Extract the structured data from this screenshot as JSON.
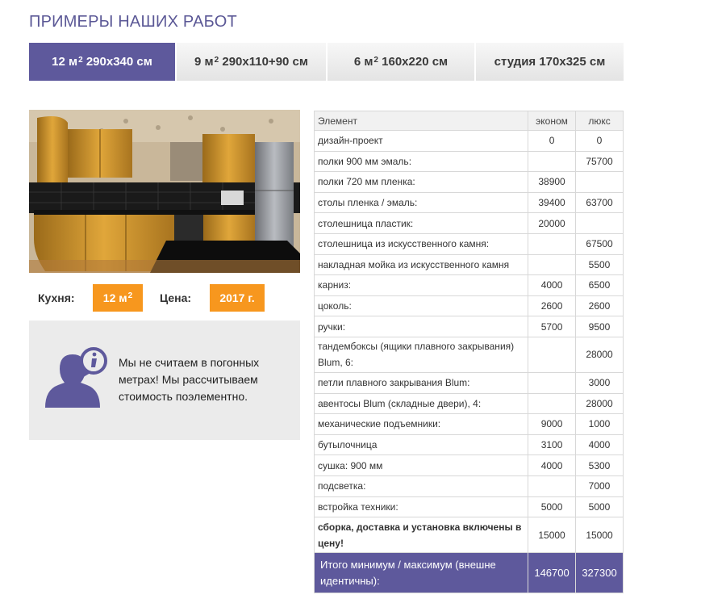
{
  "header": {
    "title": "ПРИМЕРЫ НАШИХ РАБОТ"
  },
  "tabs": [
    {
      "label": "12 м",
      "sup": "2",
      "size": "290х340 см",
      "active": true
    },
    {
      "label": "9 м",
      "sup": "2",
      "size": "290х110+90 см",
      "active": false
    },
    {
      "label": "6 м",
      "sup": "2",
      "size": "160х220 см",
      "active": false
    },
    {
      "label": "студия 170х325 см",
      "sup": "",
      "size": "",
      "active": false
    }
  ],
  "kitchen": {
    "kitchen_label": "Кухня:",
    "kitchen_value": "12 м",
    "kitchen_sup": "2",
    "price_label": "Цена:",
    "price_value": "2017 г."
  },
  "info": {
    "text": "Мы не считаем в погонных метрах! Мы рассчитываем стоимость поэлементно."
  },
  "table": {
    "headers": [
      "Элемент",
      "эконом",
      "люкс"
    ],
    "rows": [
      [
        "дизайн-проект",
        "0",
        "0"
      ],
      [
        "полки 900 мм эмаль:",
        "",
        "75700"
      ],
      [
        "полки 720 мм пленка:",
        "38900",
        ""
      ],
      [
        "столы пленка / эмаль:",
        "39400",
        "63700"
      ],
      [
        "столешница пластик:",
        "20000",
        ""
      ],
      [
        "столешница из искусственного камня:",
        "",
        "67500"
      ],
      [
        "накладная мойка из искусственного камня",
        "",
        "5500"
      ],
      [
        "карниз:",
        "4000",
        "6500"
      ],
      [
        "цоколь:",
        "2600",
        "2600"
      ],
      [
        "ручки:",
        "5700",
        "9500"
      ],
      [
        "тандембоксы (ящики плавного закрывания) Blum, 6:",
        "",
        "28000"
      ],
      [
        "петли плавного закрывания Blum:",
        "",
        "3000"
      ],
      [
        "авентосы Blum (складные двери), 4:",
        "",
        "28000"
      ],
      [
        "механические подъемники:",
        "9000",
        "1000"
      ],
      [
        "бутылочница",
        "3100",
        "4000"
      ],
      [
        "сушка: 900 мм",
        "4000",
        "5300"
      ],
      [
        "подсветка:",
        "",
        "7000"
      ],
      [
        "встройка техники:",
        "5000",
        "5000"
      ],
      [
        "сборка, доставка и установка включены в цену!",
        "15000",
        "15000"
      ]
    ],
    "total": [
      "Итого минимум / максимум (внешне идентичны):",
      "146700",
      "327300"
    ]
  },
  "colors": {
    "accent": "#5e599c",
    "badge": "#f7971e",
    "title": "#5b5896"
  }
}
